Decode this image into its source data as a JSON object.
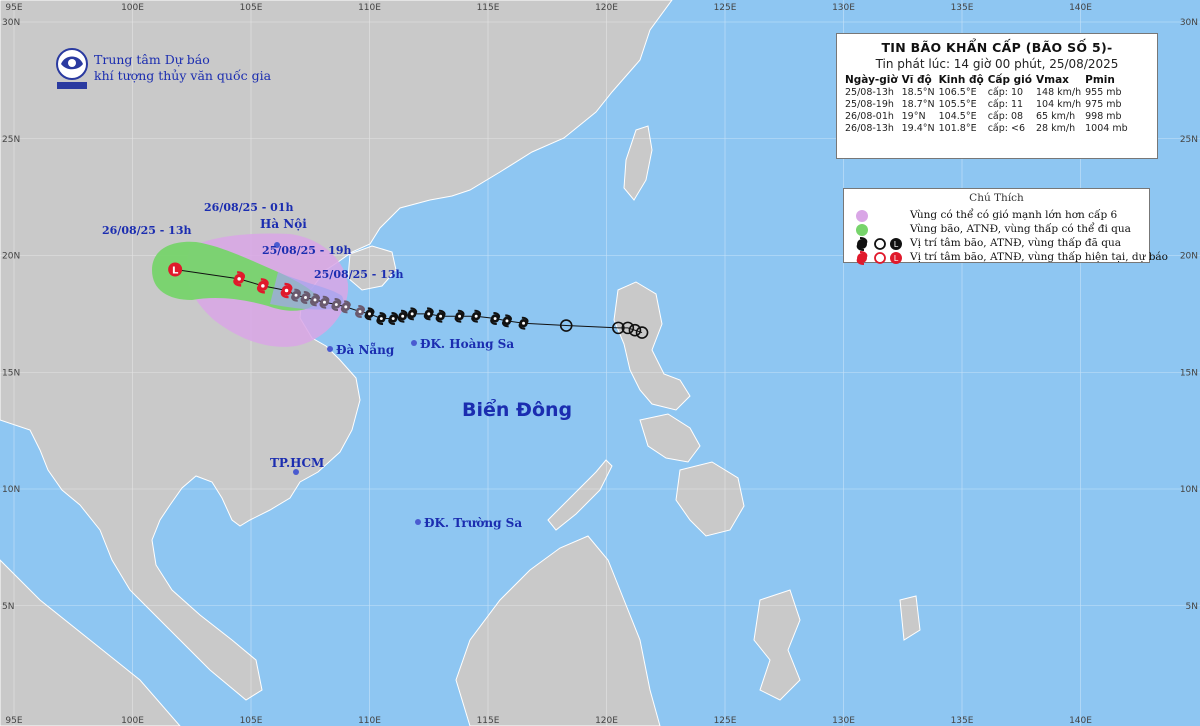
{
  "org": {
    "line1": "Trung tâm Dự báo",
    "line2": "khí tượng thủy văn quốc gia",
    "logo_text": "NCHMF"
  },
  "bulletin": {
    "title": "TIN BÃO KHẨN CẤP (BÃO SỐ 5)-",
    "issued": "Tin phát lúc: 14 giờ 00 phút, 25/08/2025",
    "headers": [
      "Ngày-giờ",
      "Vĩ độ",
      "Kinh độ",
      "Cấp gió",
      "Vmax",
      "Pmin"
    ],
    "rows": [
      [
        "25/08-13h",
        "18.5°N",
        "106.5°E",
        "cấp: 10",
        "148 km/h",
        "955 mb"
      ],
      [
        "25/08-19h",
        "18.7°N",
        "105.5°E",
        "cấp: 11",
        "104 km/h",
        "975 mb"
      ],
      [
        "26/08-01h",
        "19°N",
        "104.5°E",
        "cấp: 08",
        "65 km/h",
        "998 mb"
      ],
      [
        "26/08-13h",
        "19.4°N",
        "101.8°E",
        "cấp: <6",
        "28 km/h",
        "1004 mb"
      ]
    ]
  },
  "legend": {
    "title": "Chú Thích",
    "items": [
      {
        "label": "Vùng có thể có gió mạnh lớn hơn cấp 6",
        "color": "#d9a6e6"
      },
      {
        "label": "Vùng bão, ATNĐ, vùng thấp có thể đi qua",
        "color": "#77d46b"
      },
      {
        "label": "Vị trí tâm bão, ATNĐ, vùng thấp đã qua",
        "color": "#111111"
      },
      {
        "label": "Vị trí tâm bão, ATNĐ, vùng thấp hiện tại, dự báo",
        "color": "#e0192b"
      }
    ]
  },
  "places": {
    "hanoi": "Hà Nội",
    "danang": "Đà Nẵng",
    "hoangsa": "ĐK. Hoàng Sa",
    "truongsa": "ĐK. Trường Sa",
    "tphcm": "TP.HCM",
    "sea": "Biển Đông"
  },
  "track_labels": {
    "t1": "25/08/25 - 13h",
    "t2": "25/08/25 - 19h",
    "t3": "26/08/25 - 01h",
    "t4": "26/08/25 - 13h"
  },
  "grid": {
    "lon_labels": [
      "95E",
      "100E",
      "105E",
      "110E",
      "115E",
      "120E",
      "125E",
      "130E",
      "135E",
      "140E"
    ],
    "lat_labels": [
      "30N",
      "25N",
      "20N",
      "15N",
      "10N",
      "5N"
    ]
  },
  "colors": {
    "sea": "#8ec6f2",
    "land": "#c9c9c9",
    "text_blue": "#1b2db0"
  },
  "track": {
    "past": [
      [
        121.5,
        16.7
      ],
      [
        121.2,
        16.8
      ],
      [
        120.9,
        16.9
      ],
      [
        120.5,
        16.9
      ],
      [
        118.3,
        17.0
      ],
      [
        116.5,
        17.1
      ],
      [
        115.8,
        17.2
      ],
      [
        115.3,
        17.3
      ],
      [
        114.5,
        17.4
      ],
      [
        113.8,
        17.4
      ],
      [
        113.0,
        17.4
      ],
      [
        112.5,
        17.5
      ],
      [
        111.8,
        17.5
      ],
      [
        111.4,
        17.4
      ],
      [
        111.0,
        17.3
      ],
      [
        110.5,
        17.3
      ],
      [
        110.0,
        17.5
      ],
      [
        109.6,
        17.6
      ],
      [
        109.0,
        17.8
      ],
      [
        108.6,
        17.9
      ],
      [
        108.1,
        18.0
      ],
      [
        107.7,
        18.1
      ],
      [
        107.3,
        18.2
      ],
      [
        106.9,
        18.3
      ]
    ],
    "forecast": [
      {
        "lon": 106.5,
        "lat": 18.5,
        "sym": "storm"
      },
      {
        "lon": 105.5,
        "lat": 18.7,
        "sym": "storm"
      },
      {
        "lon": 104.5,
        "lat": 19.0,
        "sym": "storm"
      },
      {
        "lon": 101.8,
        "lat": 19.4,
        "sym": "low"
      }
    ]
  }
}
